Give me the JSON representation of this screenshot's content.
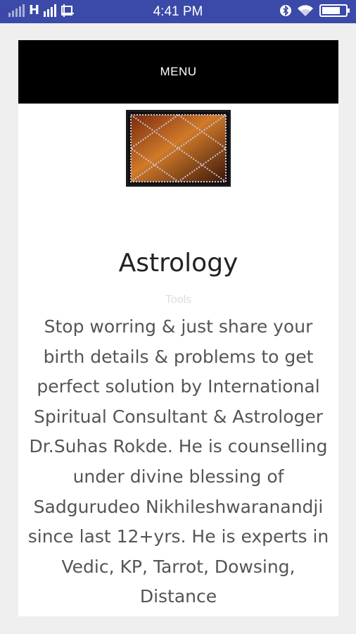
{
  "status_bar": {
    "time": "4:41 PM",
    "carrier_text": "H",
    "colors": {
      "background": "#3b4aa8",
      "foreground": "#ffffff"
    },
    "battery_level": 0.8
  },
  "page": {
    "menu_label": "MENU",
    "heading": "Astrology",
    "subheading": "Tools",
    "description": "Stop worring & just share your birth details & problems to get perfect solution by International Spiritual Consultant & Astrologer Dr.Suhas Rokde. He is counselling under divine blessing of Sadgurudeo Nikhileshwaranandji since last 12+yrs. He is experts in Vedic, KP, Tarrot, Dowsing, Distance",
    "colors": {
      "page_background": "#ffffff",
      "outer_background": "#efefef",
      "menu_background": "#000000",
      "heading": "#222222",
      "body_text": "#555555"
    },
    "logo_icon": "astrology-chart-icon"
  }
}
